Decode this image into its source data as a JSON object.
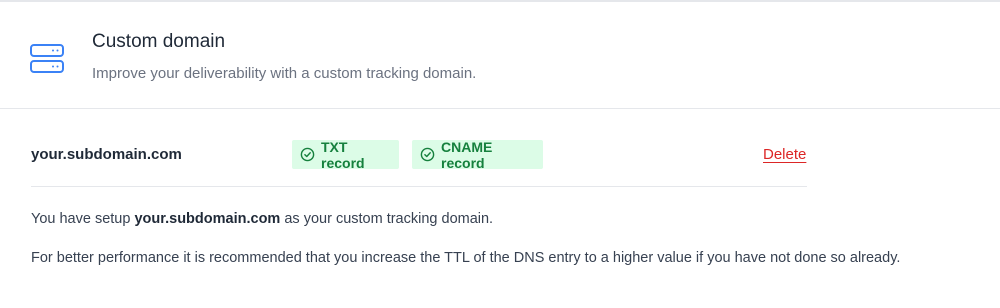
{
  "header": {
    "icon": "server-stack-icon",
    "title": "Custom domain",
    "subtitle": "Improve your deliverability with a custom tracking domain."
  },
  "domain": {
    "name": "your.subdomain.com",
    "badges": [
      {
        "label": "TXT record",
        "icon": "check-circle-icon",
        "status": "verified"
      },
      {
        "label": "CNAME record",
        "icon": "check-circle-icon",
        "status": "verified"
      }
    ],
    "delete_label": "Delete"
  },
  "info": {
    "setup_prefix": "You have setup",
    "setup_domain": "your.subdomain.com",
    "setup_suffix": "as your custom tracking domain.",
    "performance_note": "For better performance it is recommended that you increase the TTL of the DNS entry to a higher value if you have not done so already."
  },
  "colors": {
    "accent_icon": "#3b82f6",
    "badge_bg": "#dcfce7",
    "badge_text": "#15803d",
    "delete": "#dc2626",
    "divider": "#e5e7eb"
  }
}
